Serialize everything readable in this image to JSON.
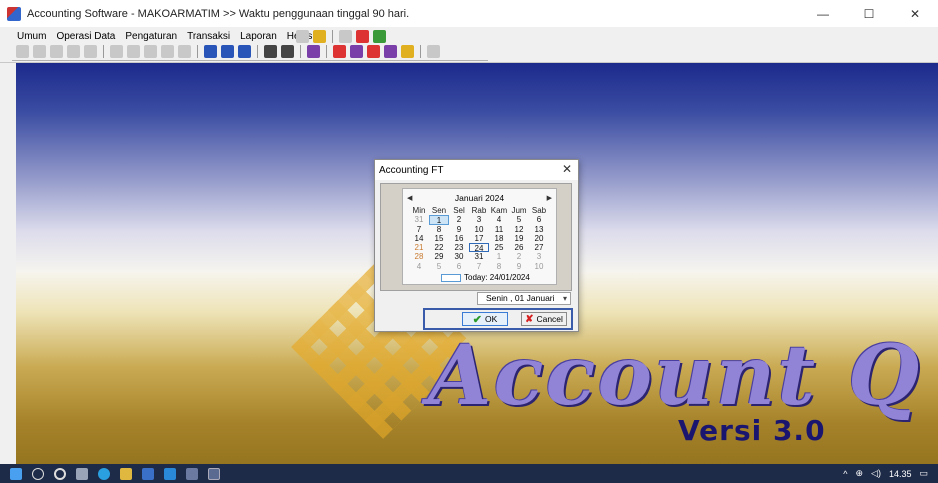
{
  "window": {
    "title": "Accounting Software - MAKOARMATIM >> Waktu penggunaan tinggal 90 hari.",
    "controls": [
      "—",
      "☐",
      "✕"
    ]
  },
  "menu": {
    "items": [
      "Umum",
      "Operasi Data",
      "Pengaturan",
      "Transaksi",
      "Laporan",
      "Helps"
    ]
  },
  "brand": {
    "name": "Account Q",
    "version": "Versi 3.0"
  },
  "dialog": {
    "title": "Accounting FT",
    "close": "✕",
    "calendar": {
      "month_label": "Januari 2024",
      "prev": "◀",
      "next": "▶",
      "weekday_headers": [
        "Min",
        "Sen",
        "Sel",
        "Rab",
        "Kam",
        "Jum",
        "Sab"
      ],
      "weeks": [
        [
          "31",
          "1",
          "2",
          "3",
          "4",
          "5",
          "6"
        ],
        [
          "7",
          "8",
          "9",
          "10",
          "11",
          "12",
          "13"
        ],
        [
          "14",
          "15",
          "16",
          "17",
          "18",
          "19",
          "20"
        ],
        [
          "21",
          "22",
          "23",
          "24",
          "25",
          "26",
          "27"
        ],
        [
          "28",
          "29",
          "30",
          "31",
          "1",
          "2",
          "3"
        ],
        [
          "4",
          "5",
          "6",
          "7",
          "8",
          "9",
          "10"
        ]
      ],
      "today_label": "Today: 24/01/2024"
    },
    "date_select_value": "Senin , 01   Januari",
    "ok_label": "OK",
    "cancel_label": "Cancel"
  },
  "taskbar": {
    "time": "14.35",
    "tray_text": "^"
  },
  "colors": {
    "accent": "#3a5aaa",
    "brand_text": "#9184d6",
    "version_text": "#1a1670",
    "taskbar": "#1e2b48"
  }
}
